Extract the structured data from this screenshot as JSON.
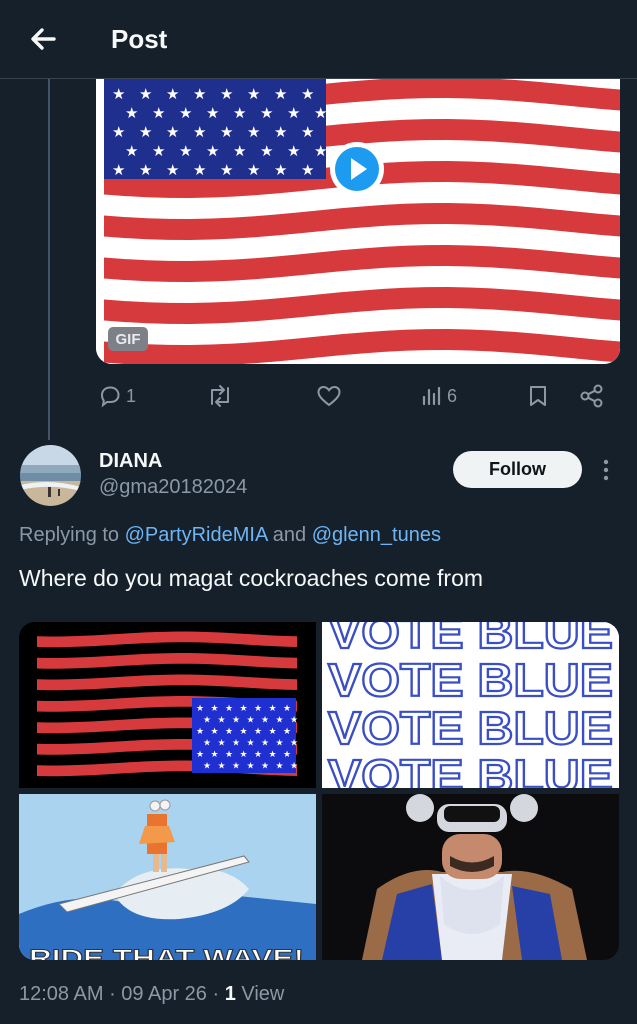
{
  "header": {
    "title": "Post"
  },
  "media1": {
    "badge": "GIF"
  },
  "actions": {
    "replies": "1",
    "reposts": "",
    "likes": "",
    "views": "6"
  },
  "reply": {
    "author_name": "DIANA",
    "author_handle": "@gma20182024",
    "follow_label": "Follow",
    "replying_prefix": "Replying to ",
    "replying_user1": "@PartyRideMIA",
    "replying_and": " and ",
    "replying_user2": "@glenn_tunes",
    "text": "Where do you magat cockroaches come from",
    "vote_text": "VOTE BLUE",
    "wave_text": "RIDE THAT WAVE!",
    "time": "12:08 AM",
    "sep": " · ",
    "date": "09 Apr 26",
    "views_count": "1",
    "views_label": " View"
  },
  "colors": {
    "background": "#15202b",
    "link": "#6fb5f5",
    "muted": "#8b98a5",
    "flag_red": "#d63a3d",
    "flag_blue": "#1f2f8e"
  }
}
